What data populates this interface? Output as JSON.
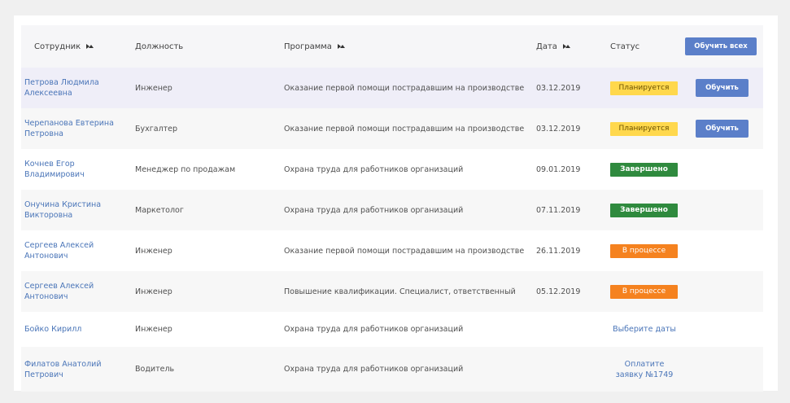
{
  "header": {
    "employee": "Сотрудник",
    "position": "Должность",
    "program": "Программа",
    "date": "Дата",
    "status": "Статус",
    "train_all_button": "Обучить всех"
  },
  "rows": [
    {
      "name_line1": "Петрова Людмила",
      "name_line2": "Алексеевна",
      "position": "Инженер",
      "program": "Оказание первой помощи пострадавшим на производстве",
      "date": "03.12.2019",
      "status": "Планируется",
      "status_kind": "plan",
      "action": "Обучить"
    },
    {
      "name_line1": "Черепанова Евтерина",
      "name_line2": "Петровна",
      "position": "Бухгалтер",
      "program": "Оказание первой помощи пострадавшим на производстве",
      "date": "03.12.2019",
      "status": "Планируется",
      "status_kind": "plan",
      "action": "Обучить"
    },
    {
      "name_line1": "Кочнев Егор",
      "name_line2": "Владимирович",
      "position": "Менеджер по продажам",
      "program": "Охрана труда для работников организаций",
      "date": "09.01.2019",
      "status": "Завершено",
      "status_kind": "done"
    },
    {
      "name_line1": "Онучина Кристина",
      "name_line2": "Викторовна",
      "position": "Маркетолог",
      "program": "Охрана труда для работников организаций",
      "date": "07.11.2019",
      "status": "Завершено",
      "status_kind": "done"
    },
    {
      "name_line1": "Сергеев Алексей",
      "name_line2": "Антонович",
      "position": "Инженер",
      "program": "Оказание первой помощи пострадавшим на производстве",
      "date": "26.11.2019",
      "status": "В процессе",
      "status_kind": "process"
    },
    {
      "name_line1": "Сергеев Алексей",
      "name_line2": "Антонович",
      "position": "Инженер",
      "program": "Повышение квалификации. Специалист, ответственный",
      "date": "05.12.2019",
      "status": "В процессе",
      "status_kind": "process"
    },
    {
      "name_line1": "Бойко Кирилл",
      "position": "Инженер",
      "program": "Охрана труда для работников организаций",
      "status_link": "Выберите даты"
    },
    {
      "name_line1": "Филатов Анатолий",
      "name_line2": "Петрович",
      "position": "Водитель",
      "program": "Охрана труда для работников организаций",
      "status_link_line1": "Оплатите",
      "status_link_line2": "заявку №1749"
    }
  ],
  "colors": {
    "accent": "#5b7fc9",
    "link": "#4a75b8",
    "plan": "#ffd84d",
    "done": "#2f8a3e",
    "process": "#f5821f",
    "highlight_row": "#efeef8"
  },
  "icons": {
    "sort": "sort-icon"
  }
}
